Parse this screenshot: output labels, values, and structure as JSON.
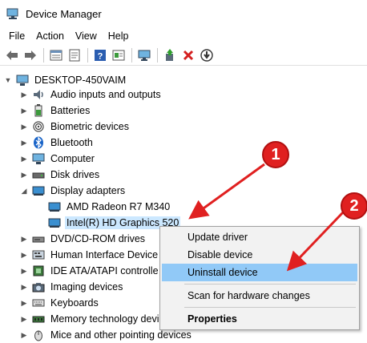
{
  "window": {
    "title": "Device Manager"
  },
  "menu": [
    "File",
    "Action",
    "View",
    "Help"
  ],
  "toolbar": [
    "back-icon",
    "forward-icon",
    "properties-icon",
    "refresh-icon",
    "help-icon",
    "update-icon",
    "monitor-icon",
    "add-driver-icon",
    "uninstall-icon",
    "download-icon"
  ],
  "tree": {
    "root": "DESKTOP-450VAIM",
    "items": [
      {
        "label": "Audio inputs and outputs",
        "icon": "audio-icon"
      },
      {
        "label": "Batteries",
        "icon": "battery-icon"
      },
      {
        "label": "Biometric devices",
        "icon": "biometric-icon"
      },
      {
        "label": "Bluetooth",
        "icon": "bluetooth-icon"
      },
      {
        "label": "Computer",
        "icon": "computer-icon"
      },
      {
        "label": "Disk drives",
        "icon": "disk-icon"
      },
      {
        "label": "Display adapters",
        "icon": "display-adapter-icon"
      },
      {
        "label": "AMD Radeon R7 M340",
        "icon": "display-adapter-icon"
      },
      {
        "label": "Intel(R) HD Graphics 520",
        "icon": "display-adapter-icon"
      },
      {
        "label": "DVD/CD-ROM drives",
        "icon": "dvd-icon"
      },
      {
        "label": "Human Interface Device",
        "icon": "hid-icon"
      },
      {
        "label": "IDE ATA/ATAPI controlle",
        "icon": "ide-icon"
      },
      {
        "label": "Imaging devices",
        "icon": "camera-icon"
      },
      {
        "label": "Keyboards",
        "icon": "keyboard-icon"
      },
      {
        "label": "Memory technology devi",
        "icon": "memory-icon"
      },
      {
        "label": "Mice and other pointing devices",
        "icon": "mouse-icon"
      }
    ]
  },
  "context_menu": {
    "update": "Update driver",
    "disable": "Disable device",
    "uninstall": "Uninstall device",
    "scan": "Scan for hardware changes",
    "properties": "Properties"
  },
  "callouts": {
    "one": "1",
    "two": "2"
  },
  "colors": {
    "accent": "#e02020",
    "selection": "#cce8ff",
    "menu_highlight": "#91c9f7"
  }
}
